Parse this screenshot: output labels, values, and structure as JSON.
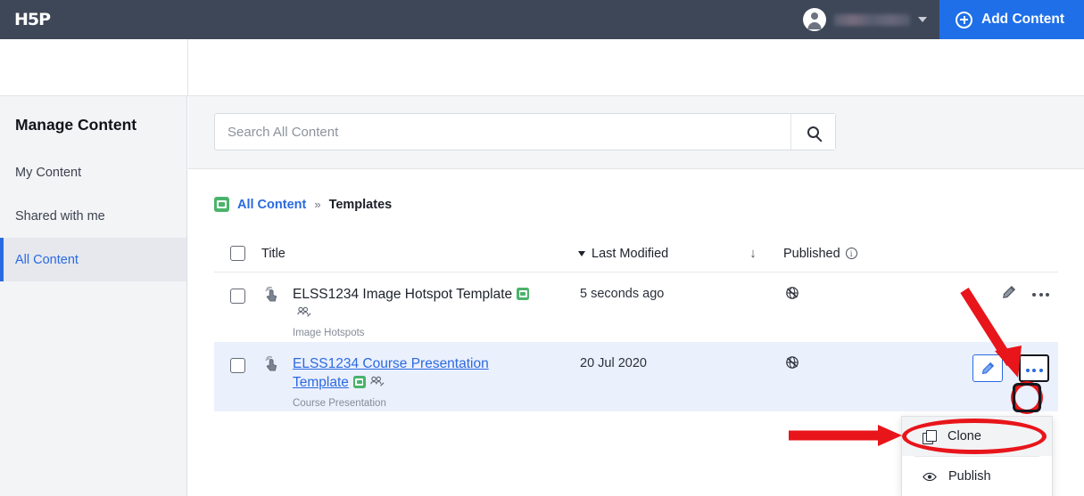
{
  "topbar": {
    "logo": "H5P",
    "user_name_redacted": "",
    "caret_icon": "chevron-down-icon",
    "add_content_label": "Add Content",
    "add_icon": "plus-circle-icon",
    "accent_blue": "#1e6fe8",
    "bar_color": "#3d4757"
  },
  "sidebar": {
    "title": "Manage Content",
    "items": [
      {
        "label": "My Content",
        "active": false
      },
      {
        "label": "Shared with me",
        "active": false
      },
      {
        "label": "All Content",
        "active": true
      }
    ],
    "active_color": "#2a6ae0"
  },
  "search": {
    "placeholder": "Search All Content",
    "value": "",
    "button_icon": "search-icon"
  },
  "breadcrumb": {
    "icon": "content-type-icon",
    "root": "All Content",
    "separator": "»",
    "current": "Templates"
  },
  "table": {
    "headers": {
      "title": "Title",
      "last_modified": "Last Modified",
      "sort_direction": "↓",
      "published": "Published",
      "info_icon": "info-icon",
      "sort_caret_icon": "caret-down-icon"
    },
    "rows": [
      {
        "title": "ELSS1234 Image Hotspot Template",
        "title_is_link": false,
        "subtype": "Image Hotspots",
        "last_modified": "5 seconds ago",
        "published_icon": "globe-slash-icon",
        "type_icon": "tap-hand-icon",
        "badge_icon": "content-type-icon",
        "shared_icon": "shared-users-icon",
        "selected": false,
        "edit_icon": "pencil-icon",
        "more_icon": "ellipsis-icon"
      },
      {
        "title_line1": "ELSS1234 Course Presentation",
        "title_line2": "Template",
        "title_is_link": true,
        "subtype": "Course Presentation",
        "last_modified": "20 Jul 2020",
        "published_icon": "globe-slash-icon",
        "type_icon": "tap-hand-icon",
        "badge_icon": "content-type-icon",
        "shared_icon": "shared-users-icon",
        "selected": true,
        "edit_icon": "pencil-icon",
        "more_icon": "ellipsis-icon"
      }
    ]
  },
  "dropdown": {
    "items": [
      {
        "label": "Clone",
        "icon": "copy-icon",
        "highlighted": true
      },
      {
        "label": "Publish",
        "icon": "eye-icon",
        "highlighted": false
      }
    ]
  },
  "annotations": {
    "color": "#e8151a",
    "arrow_to_more_button": "diagonal-arrow-down-right",
    "arrow_to_clone": "horizontal-arrow-right",
    "ellipse_more_button": "red-ellipse",
    "ellipse_clone_item": "red-ellipse",
    "box_more_button": "black-rounded-box"
  }
}
